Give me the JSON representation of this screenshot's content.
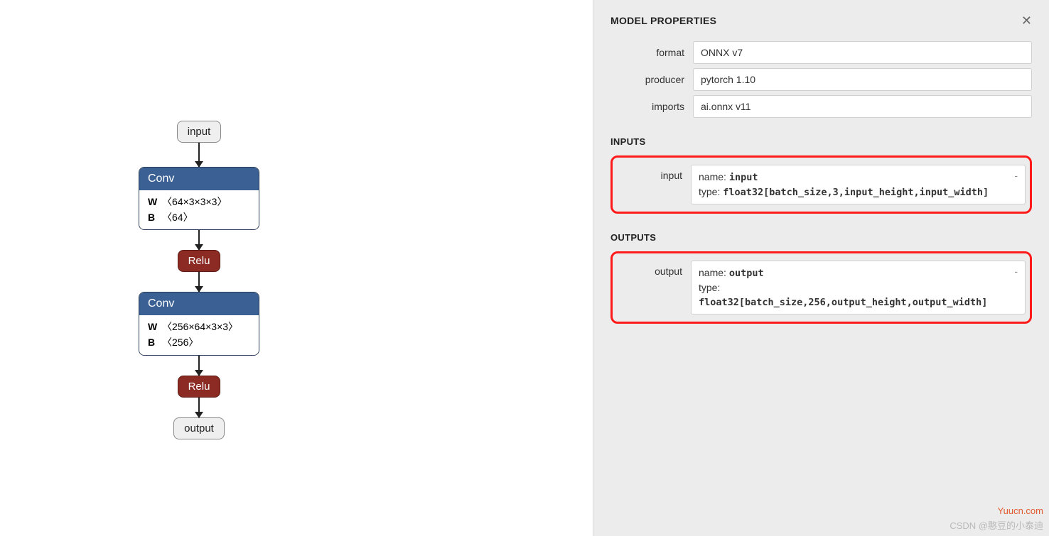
{
  "graph": {
    "input_node": "input",
    "output_node": "output",
    "conv1": {
      "label": "Conv",
      "w_label": "W",
      "w_dims": "〈64×3×3×3〉",
      "b_label": "B",
      "b_dims": "〈64〉"
    },
    "relu1": "Relu",
    "conv2": {
      "label": "Conv",
      "w_label": "W",
      "w_dims": "〈256×64×3×3〉",
      "b_label": "B",
      "b_dims": "〈256〉"
    },
    "relu2": "Relu"
  },
  "panel": {
    "title": "MODEL PROPERTIES",
    "props": {
      "format": {
        "label": "format",
        "value": "ONNX v7"
      },
      "producer": {
        "label": "producer",
        "value": "pytorch 1.10"
      },
      "imports": {
        "label": "imports",
        "value": "ai.onnx v11"
      }
    },
    "inputs_title": "INPUTS",
    "input": {
      "row_label": "input",
      "name_label": "name:",
      "name_value": "input",
      "type_label": "type:",
      "type_value": "float32[batch_size,3,input_height,input_width]"
    },
    "outputs_title": "OUTPUTS",
    "output": {
      "row_label": "output",
      "name_label": "name:",
      "name_value": "output",
      "type_label": "type:",
      "type_value": "float32[batch_size,256,output_height,output_width]"
    }
  },
  "watermark": {
    "site": "Yuucn.com",
    "credit": "CSDN @憨豆的小泰迪"
  }
}
